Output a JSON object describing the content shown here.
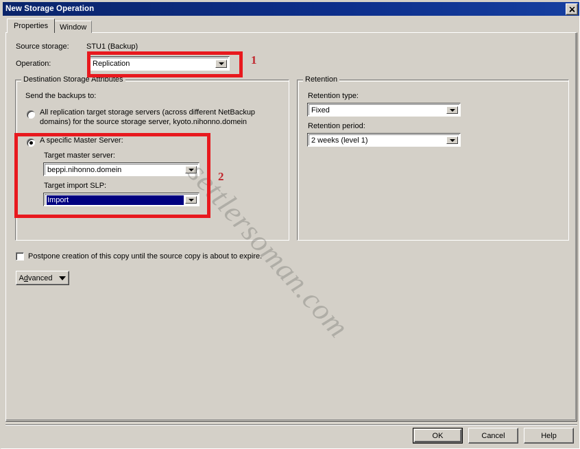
{
  "window": {
    "title": "New Storage Operation",
    "close_icon": "close-icon"
  },
  "tabs": [
    {
      "label": "Properties",
      "active": true
    },
    {
      "label": "Window",
      "active": false
    }
  ],
  "properties": {
    "source_storage_label": "Source storage:",
    "source_storage_value": "STU1 (Backup)",
    "operation_label": "Operation:",
    "operation_value": "Replication"
  },
  "destination_group": {
    "title": "Destination Storage Attributes",
    "send_to_label": "Send the backups to:",
    "option_all": {
      "line1": "All replication target storage servers (across different NetBackup",
      "line2": "domains) for the source storage server, kyoto.nihonno.domein",
      "selected": false
    },
    "option_specific": {
      "label": "A specific Master Server:",
      "selected": true
    },
    "target_master_server_label": "Target master server:",
    "target_master_server_value": "beppi.nihonno.domein",
    "target_import_slp_label": "Target import SLP:",
    "target_import_slp_value": "Import"
  },
  "retention_group": {
    "title": "Retention",
    "retention_type_label": "Retention type:",
    "retention_type_value": "Fixed",
    "retention_period_label": "Retention period:",
    "retention_period_value": "2 weeks (level 1)"
  },
  "postpone": {
    "label": "Postpone creation of this copy until the source copy is about to expire.",
    "checked": false
  },
  "advanced_button": {
    "prefix": "A",
    "mnemonic": "d",
    "suffix": "vanced"
  },
  "footer": {
    "ok": "OK",
    "cancel": "Cancel",
    "help": "Help"
  },
  "annotations": {
    "one": "1",
    "two": "2",
    "color": "#e8191e"
  },
  "watermark": {
    "text": "settlersoman.com"
  }
}
